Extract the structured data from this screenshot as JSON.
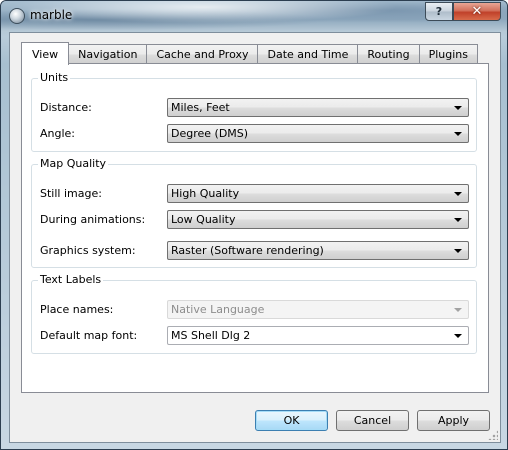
{
  "window": {
    "title": "marble",
    "help_glyph": "?",
    "close_glyph": "✕"
  },
  "tabs": [
    {
      "label": "View",
      "active": true
    },
    {
      "label": "Navigation",
      "active": false
    },
    {
      "label": "Cache and Proxy",
      "active": false
    },
    {
      "label": "Date and Time",
      "active": false
    },
    {
      "label": "Routing",
      "active": false
    },
    {
      "label": "Plugins",
      "active": false
    }
  ],
  "units": {
    "title": "Units",
    "distance_label": "Distance:",
    "distance_value": "Miles, Feet",
    "angle_label": "Angle:",
    "angle_value": "Degree (DMS)"
  },
  "map_quality": {
    "title": "Map Quality",
    "still_label": "Still image:",
    "still_value": "High Quality",
    "anim_label": "During animations:",
    "anim_value": "Low Quality",
    "graphics_label": "Graphics system:",
    "graphics_value": "Raster (Software rendering)"
  },
  "text_labels": {
    "title": "Text Labels",
    "place_label": "Place names:",
    "place_value": "Native Language",
    "font_label": "Default map font:",
    "font_value": "MS Shell Dlg 2"
  },
  "buttons": {
    "ok": "OK",
    "cancel": "Cancel",
    "apply": "Apply"
  }
}
